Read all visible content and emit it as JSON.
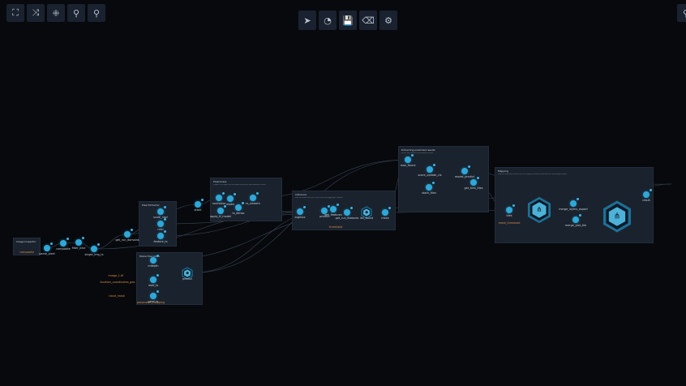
{
  "toolbar_left": [
    {
      "name": "fit-view",
      "icon": "⛶"
    },
    {
      "name": "shuffle",
      "icon": "⤨"
    },
    {
      "name": "collapse",
      "icon": "⁜"
    },
    {
      "name": "zoom-in",
      "icon": "⚲"
    },
    {
      "name": "zoom-out",
      "icon": "⚲"
    }
  ],
  "toolbar_center": [
    {
      "name": "run",
      "icon": "➤"
    },
    {
      "name": "history",
      "icon": "◔"
    },
    {
      "name": "save",
      "icon": "💾"
    },
    {
      "name": "clear",
      "icon": "⌫"
    },
    {
      "name": "settings",
      "icon": "⚙"
    }
  ],
  "toolbar_right": [
    {
      "name": "zoom",
      "icon": "⚲"
    }
  ],
  "groups": [
    {
      "title": "Image Inspector",
      "desc": ""
    },
    {
      "title": "Pixel Extractor",
      "desc": ""
    },
    {
      "title": "Model Execution",
      "desc": ""
    },
    {
      "title": "Preprocess",
      "desc": "Prepare the inputs for the model execution and normalize values"
    },
    {
      "title": "Inference",
      "desc": "Run the model over the time series and aggregate outputs"
    },
    {
      "title": "Extracting predicted results",
      "desc": "Select and format the predicted results"
    },
    {
      "title": "Mapping",
      "desc": "Map the predicted results over the region of interest and build the final output layers"
    }
  ],
  "nodes": [
    "parse_pixel",
    "composite",
    "filter_ndvi",
    "single_img_ts",
    "get_run_domains",
    "scale_ndvi",
    "ndvi",
    "feature_ts",
    "mdepth",
    "read_ts",
    "predict",
    "pixel_ts",
    "stack",
    "normalize",
    "model",
    "ts_smooth",
    "apply_tf_model",
    "ts_dense",
    "argmax",
    "predict",
    "get_features",
    "get_run_features",
    "list_found",
    "mean",
    "max_found",
    "score_update_cls",
    "model_predict",
    "stack_tiles",
    "get_bins_tiles",
    "tiles",
    "merge_layers_export",
    "merge_plot_tile",
    "result"
  ],
  "params": [
    "composite",
    "image_1.tif",
    "location_coordinates_geo",
    "cloud_mask",
    "parameter_mapping",
    "threshold",
    "mask_threshold"
  ]
}
